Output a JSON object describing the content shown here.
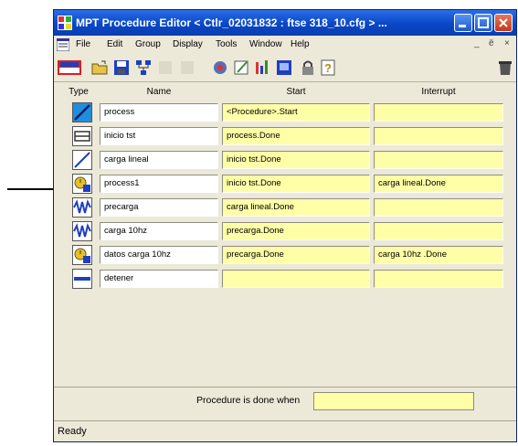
{
  "window": {
    "title": "MPT Procedure Editor  < Ctlr_02031832 : ftse 318_10.cfg > ...",
    "status": "Ready"
  },
  "menubar": {
    "items": [
      "File",
      "Edit",
      "Group",
      "Display",
      "Tools",
      "Window",
      "Help"
    ],
    "mdi_minimize": "_",
    "mdi_restore": "ё",
    "mdi_close": "×"
  },
  "toolbar": {
    "icons": [
      "mts-logo-icon",
      "open-icon",
      "save-icon",
      "network-icon",
      "blank-icon",
      "blank-icon",
      "gear-icon",
      "edit-icon",
      "chart-icon",
      "monitor-icon",
      "lock-icon",
      "help-icon",
      "waste-icon"
    ],
    "help_glyph": "?"
  },
  "columns": {
    "type": "Type",
    "name": "Name",
    "start": "Start",
    "interrupt": "Interrupt"
  },
  "rows": [
    {
      "type": "ramp",
      "name": "process",
      "start": "<Procedure>.Start",
      "interrupt": ""
    },
    {
      "type": "hold",
      "name": "inicio tst",
      "start": "process.Done",
      "interrupt": ""
    },
    {
      "type": "ramp",
      "name": "carga lineal",
      "start": "inicio tst.Done",
      "interrupt": ""
    },
    {
      "type": "data",
      "name": "process1",
      "start": "inicio tst.Done",
      "interrupt": "carga lineal.Done"
    },
    {
      "type": "cyclic",
      "name": "precarga",
      "start": "carga lineal.Done",
      "interrupt": ""
    },
    {
      "type": "cyclic",
      "name": "carga 10hz",
      "start": "precarga.Done",
      "interrupt": ""
    },
    {
      "type": "data",
      "name": "datos carga 10hz",
      "start": "precarga.Done",
      "interrupt": "carga 10hz .Done"
    },
    {
      "type": "stop",
      "name": "detener",
      "start": "",
      "interrupt": ""
    }
  ],
  "footer": {
    "done_label": "Procedure is done when",
    "done_value": ""
  },
  "colors": {
    "title_bar": "#0a46c6",
    "field_yellow": "#ffffa8",
    "chrome": "#ece9d8",
    "icon_blue": "#1f3fbf"
  }
}
